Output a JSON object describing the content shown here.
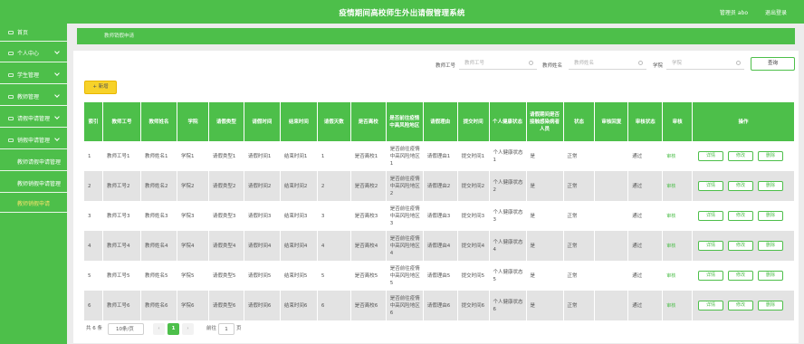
{
  "header": {
    "title": "疫情期间高校师生外出请假管理系统",
    "user": "管理员 abo",
    "logout": "退出登录"
  },
  "sidebar": {
    "items": [
      {
        "label": "首页"
      },
      {
        "label": "个人中心"
      },
      {
        "label": "学生管理"
      },
      {
        "label": "教师管理"
      },
      {
        "label": "请假申请管理"
      },
      {
        "label": "销假申请管理"
      },
      {
        "label": "教师请假申请管理"
      },
      {
        "label": "教师销假申请管理"
      },
      {
        "label": "教师销假申请"
      }
    ]
  },
  "breadcrumb": "教师销假申请",
  "search": {
    "label1": "教师工号",
    "placeholder1": "教师工号",
    "label2": "教师姓名",
    "placeholder2": "教师姓名",
    "label3": "学院",
    "placeholder3": "学院",
    "query": "查询"
  },
  "add_button": "+ 新增",
  "table": {
    "headers": [
      "索引",
      "教师工号",
      "教师姓名",
      "学院",
      "请假类型",
      "请假时间",
      "结束时间",
      "请假天数",
      "是否离校",
      "是否前往疫情中高风险地区",
      "请假理由",
      "提交时间",
      "个人健康状态",
      "请假期间是否接触感染病者人员",
      "状态",
      "审核回复",
      "审核状态",
      "审核",
      "操作"
    ],
    "rows": [
      [
        "1",
        "教师工号1",
        "教师姓名1",
        "学院1",
        "请假类型1",
        "请假时间1",
        "结束时间1",
        "1",
        "是否离校1",
        "是否前往疫情中高风险地区1",
        "请假理由1",
        "提交时间1",
        "个人健康状态1",
        "是",
        "正常",
        "",
        "通过"
      ],
      [
        "2",
        "教师工号2",
        "教师姓名2",
        "学院2",
        "请假类型2",
        "请假时间2",
        "结束时间2",
        "2",
        "是否离校2",
        "是否前往疫情中高风险地区2",
        "请假理由2",
        "提交时间2",
        "个人健康状态2",
        "是",
        "正常",
        "",
        "通过"
      ],
      [
        "3",
        "教师工号3",
        "教师姓名3",
        "学院3",
        "请假类型3",
        "请假时间3",
        "结束时间3",
        "3",
        "是否离校3",
        "是否前往疫情中高风险地区3",
        "请假理由3",
        "提交时间3",
        "个人健康状态3",
        "是",
        "正常",
        "",
        "通过"
      ],
      [
        "4",
        "教师工号4",
        "教师姓名4",
        "学院4",
        "请假类型4",
        "请假时间4",
        "结束时间4",
        "4",
        "是否离校4",
        "是否前往疫情中高风险地区4",
        "请假理由4",
        "提交时间4",
        "个人健康状态4",
        "是",
        "正常",
        "",
        "通过"
      ],
      [
        "5",
        "教师工号5",
        "教师姓名5",
        "学院5",
        "请假类型5",
        "请假时间5",
        "结束时间5",
        "5",
        "是否离校5",
        "是否前往疫情中高风险地区5",
        "请假理由5",
        "提交时间5",
        "个人健康状态5",
        "是",
        "正常",
        "",
        "通过"
      ],
      [
        "6",
        "教师工号6",
        "教师姓名6",
        "学院6",
        "请假类型6",
        "请假时间6",
        "结束时间6",
        "6",
        "是否离校6",
        "是否前往疫情中高风险地区6",
        "请假理由6",
        "提交时间6",
        "个人健康状态6",
        "是",
        "正常",
        "",
        "通过"
      ]
    ],
    "audit_label": "审核",
    "actions": {
      "detail": "详情",
      "edit": "修改",
      "delete": "删除"
    }
  },
  "pager": {
    "total": "共 6 条",
    "size": "10条/页",
    "prev": "‹",
    "page": "1",
    "next": "›",
    "goto": "前往",
    "goto_value": "1",
    "page_unit": "页"
  },
  "colors": {
    "primary": "#4dbf4a",
    "add_button": "#f7d22a",
    "row_alt": "#e3e3e3"
  }
}
